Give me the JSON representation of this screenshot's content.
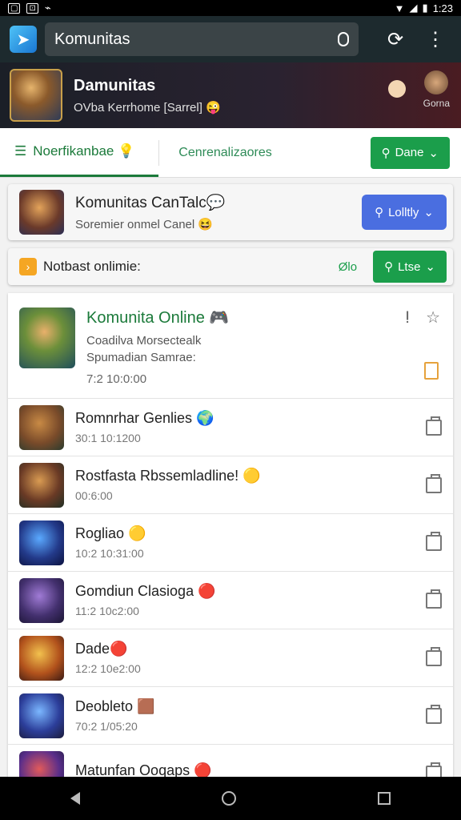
{
  "status_bar": {
    "time": "1:23",
    "left_icons": [
      "notification-icon",
      "cast-icon",
      "signal-icon"
    ],
    "right_icons": [
      "wifi-icon",
      "signal-bars-icon",
      "battery-icon"
    ]
  },
  "app_bar": {
    "search_value": "Komunitas",
    "icons": [
      "app-logo-icon",
      "mic-icon",
      "sync-icon",
      "more-vert-icon"
    ]
  },
  "banner": {
    "title": "Damunitas",
    "subtitle": "OVba Kerrhome [Sarrel] 😜",
    "right_label": "Gorna"
  },
  "tabs": {
    "active_label": "Noerfikanbae 💡",
    "second_label": "Cenrenalizaores",
    "button_label": "Dane"
  },
  "community_card": {
    "title": "Komunitas CanTalc💬",
    "subtitle": "Soremier onmel Canel 😆",
    "button_label": "Lolltly"
  },
  "notice_card": {
    "label": "Notbast onlimie:",
    "count": "Ølo",
    "button_label": "Ltse"
  },
  "featured": {
    "title": "Komunita Online 🎮",
    "line1": "Coadilva Morsectealk",
    "line2": "Spumadian Samrae:",
    "time": "7:2  10:0:00"
  },
  "items": [
    {
      "title": "Romnrhar Genlies 🌍",
      "time": "30:1  10:1200",
      "colors": [
        "#c88a45",
        "#7a4b2a",
        "#2a3b2e"
      ]
    },
    {
      "title": "Rostfasta Rbssemladline! 🟡",
      "time": "00:6:00",
      "colors": [
        "#d99b52",
        "#6a3a25",
        "#1f2e24"
      ]
    },
    {
      "title": "Rogliao 🟡",
      "time": "10:2  10:31:00",
      "colors": [
        "#5aa9ff",
        "#233a8a",
        "#0c1240"
      ]
    },
    {
      "title": "Gomdiun Clasioga 🔴",
      "time": "11:2  10c2:00",
      "colors": [
        "#a07bd6",
        "#43306e",
        "#1a1433"
      ]
    },
    {
      "title": "Dade🔴",
      "time": "12:2  10e2:00",
      "colors": [
        "#f2c14e",
        "#b2521c",
        "#3a1a14"
      ]
    },
    {
      "title": "Deobleto 🟫",
      "time": "70:2  1/05:20",
      "colors": [
        "#7bb7ff",
        "#2c3e9a",
        "#1b1b3a"
      ]
    },
    {
      "title": "Matunfan Ooqaps 🔴",
      "time": "",
      "colors": [
        "#e25a5a",
        "#5a2e8a",
        "#1a1a3a"
      ]
    }
  ],
  "nav_bar": {
    "icons": [
      "back-icon",
      "home-icon",
      "recents-icon"
    ]
  }
}
